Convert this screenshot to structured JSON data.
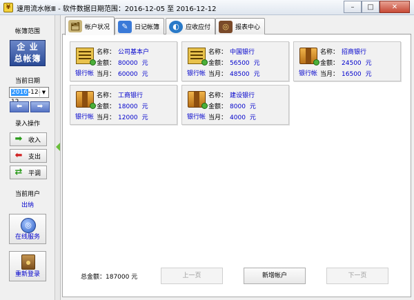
{
  "window": {
    "icon_glyph": "¥",
    "title": "速用流水帐Ⅲ - 软件数据日期范围：2016-12-05 至 2016-12-12",
    "minimize_glyph": "–",
    "maximize_glyph": "□",
    "close_glyph": "✕"
  },
  "sidebar": {
    "scope_label": "帐簿范围",
    "scope_button": {
      "line1": "企 业",
      "line2": "总帐簿"
    },
    "date_label": "当前日期",
    "date": {
      "selected_part": "2016",
      "rest": "-12-12",
      "arrow": "▼"
    },
    "nav": {
      "prev_glyph": "⬅",
      "next_glyph": "➡"
    },
    "ops_label": "录入操作",
    "ops": [
      {
        "label": "收入",
        "icon": "arrow-right-green-icon",
        "glyph": "➡",
        "color": "#2a9a1a"
      },
      {
        "label": "支出",
        "icon": "arrow-left-red-icon",
        "glyph": "⬅",
        "color": "#d02020"
      },
      {
        "label": "平调",
        "icon": "arrows-both-icon",
        "glyph": "⇄",
        "color": "#2a9a1a"
      }
    ],
    "user_label": "当前用户",
    "user_name": "出纳",
    "online_service": "在线服务",
    "relogin": "重新登录"
  },
  "tabs": [
    {
      "label": "帐户状况",
      "icon": "folder-tree-icon",
      "glyph": "🗂",
      "bg": "#c9b57a",
      "active": true
    },
    {
      "label": "日记帐簿",
      "icon": "pen-book-icon",
      "glyph": "✎",
      "bg": "#3a7ad8",
      "active": false
    },
    {
      "label": "应收应付",
      "icon": "globe-money-icon",
      "glyph": "◐",
      "bg": "#2a7ac8",
      "active": false
    },
    {
      "label": "报表中心",
      "icon": "film-reel-icon",
      "glyph": "◎",
      "bg": "#7a4a2a",
      "active": false
    }
  ],
  "labels": {
    "name": "名称：",
    "balance": "金额：",
    "month": "当月：",
    "unit": "元"
  },
  "accounts": [
    {
      "type": "银行帐",
      "icon": "bank-building-icon",
      "name": "公司基本户",
      "balance": "80000",
      "month": "60000"
    },
    {
      "type": "银行帐",
      "icon": "bank-building-icon",
      "name": "中国银行",
      "balance": "56500",
      "month": "48500"
    },
    {
      "type": "银行帐",
      "icon": "bank-box-icon",
      "name": "招商银行",
      "balance": "24500",
      "month": "16500"
    },
    {
      "type": "银行帐",
      "icon": "bank-box-icon",
      "name": "工商银行",
      "balance": "18000",
      "month": "12000"
    },
    {
      "type": "银行帐",
      "icon": "bank-box-icon",
      "name": "建设银行",
      "balance": "8000",
      "month": "4000"
    }
  ],
  "footer": {
    "total": "总金额：187000 元",
    "prev_page": "上一页",
    "add_account": "新增帐户",
    "next_page": "下一页"
  }
}
